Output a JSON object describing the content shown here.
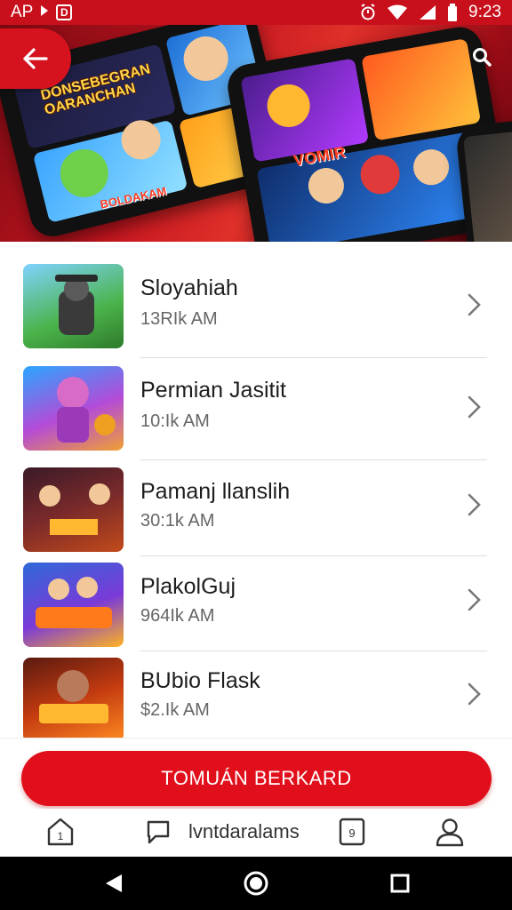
{
  "status_bar": {
    "app_label": "AP",
    "box_glyph": "D",
    "time": "9:23",
    "icons": [
      "alarm-icon",
      "wifi-icon",
      "signal-icon",
      "battery-icon"
    ]
  },
  "hero": {
    "banner_text_1": "DONSEBEGRAN OARANCHAN",
    "banner_text_2": "VOMIR",
    "banner_text_3": "BOLDAKAM",
    "back_icon": "arrow-left-icon",
    "search_icon": "search-icon"
  },
  "games": [
    {
      "title": "Sloyahiah",
      "subtitle": "13RIk AM"
    },
    {
      "title": "Permian Jasitit",
      "subtitle": "10:Ik AM"
    },
    {
      "title": "Pamanj llanslih",
      "subtitle": "30:1k AM"
    },
    {
      "title": "PlakolGuj",
      "subtitle": "964Ik AM"
    },
    {
      "title": "BUbio Flask",
      "subtitle": "$2.Ik AM"
    }
  ],
  "cta": {
    "label": "TOMUÁN BERKARD"
  },
  "bottom_nav": {
    "item_1_badge": "1",
    "item_3_label": "lvntdaralams",
    "item_4_glyph": "9",
    "icons": [
      "home-icon",
      "chat-icon",
      "card-icon",
      "profile-icon"
    ]
  },
  "colors": {
    "brand_red": "#e10f1b",
    "status_red": "#c8101c"
  }
}
